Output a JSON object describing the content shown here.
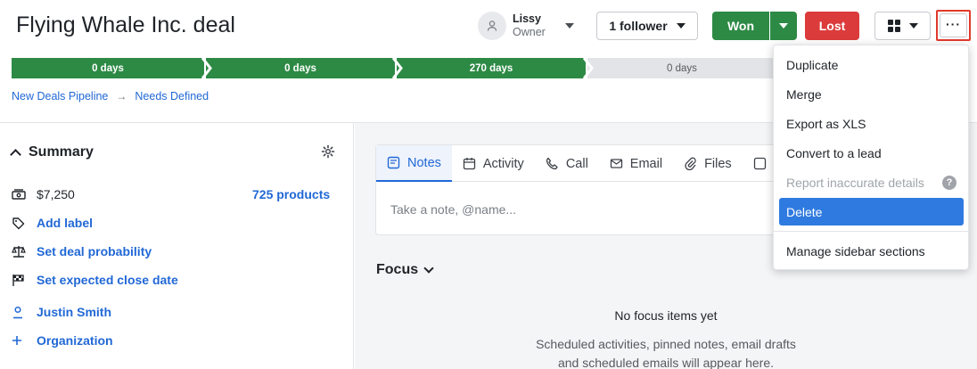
{
  "deal": {
    "title": "Flying Whale Inc. deal"
  },
  "owner": {
    "name": "Lissy",
    "role": "Owner"
  },
  "header": {
    "follower_label": "1 follower",
    "won_label": "Won",
    "lost_label": "Lost",
    "more_label": "···"
  },
  "colors": {
    "won": "#2d8a45",
    "lost": "#dc3b3b",
    "link": "#2168d6",
    "highlight": "#e03a2c",
    "menu_active": "#2f7ae0"
  },
  "pipeline": {
    "stages": [
      {
        "label": "0 days",
        "status": "done"
      },
      {
        "label": "0 days",
        "status": "done"
      },
      {
        "label": "270 days",
        "status": "done"
      },
      {
        "label": "0 days",
        "status": "todo"
      },
      {
        "label": "",
        "status": "todo"
      }
    ]
  },
  "breadcrumb": {
    "pipeline": "New Deals Pipeline",
    "separator": "→",
    "stage": "Needs Defined"
  },
  "summary": {
    "title": "Summary",
    "value": "$7,250",
    "products": "725 products",
    "add_label": "Add label",
    "probability": "Set deal probability",
    "close_date": "Set expected close date",
    "person": "Justin Smith",
    "organization": "Organization"
  },
  "composer": {
    "tabs": [
      {
        "label": "Notes",
        "icon": "note-icon"
      },
      {
        "label": "Activity",
        "icon": "calendar-icon"
      },
      {
        "label": "Call",
        "icon": "phone-icon"
      },
      {
        "label": "Email",
        "icon": "mail-icon"
      },
      {
        "label": "Files",
        "icon": "paperclip-icon"
      }
    ],
    "placeholder": "Take a note, @name..."
  },
  "focus": {
    "title": "Focus",
    "empty_title": "No focus items yet",
    "empty_line1": "Scheduled activities, pinned notes, email drafts",
    "empty_line2": "and scheduled emails will appear here."
  },
  "menu": {
    "items": [
      {
        "label": "Duplicate",
        "state": "normal"
      },
      {
        "label": "Merge",
        "state": "normal"
      },
      {
        "label": "Export as XLS",
        "state": "normal"
      },
      {
        "label": "Convert to a lead",
        "state": "normal"
      },
      {
        "label": "Report inaccurate details",
        "state": "disabled"
      },
      {
        "label": "Delete",
        "state": "active"
      },
      {
        "label": "Manage sidebar sections",
        "state": "normal"
      }
    ],
    "help_glyph": "?"
  }
}
